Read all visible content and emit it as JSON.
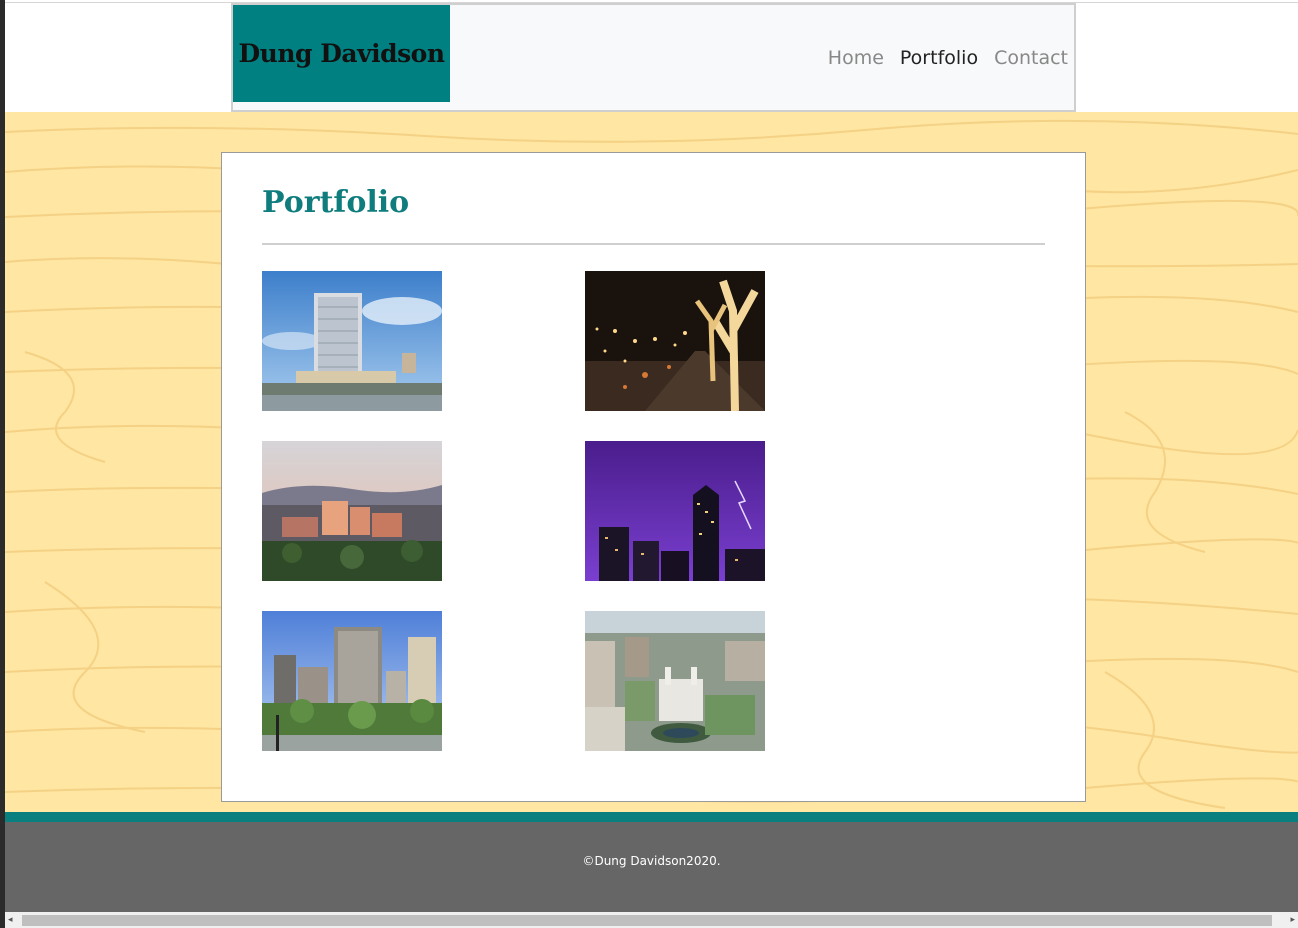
{
  "site": {
    "brand": "Dung Davidson"
  },
  "nav": {
    "items": [
      {
        "label": "Home",
        "active": false
      },
      {
        "label": "Portfolio",
        "active": true
      },
      {
        "label": "Contact",
        "active": false
      }
    ]
  },
  "main": {
    "title": "Portfolio",
    "gallery": [
      {
        "subject": "hotel-tower-daytime"
      },
      {
        "subject": "street-trees-holiday-lights-night"
      },
      {
        "subject": "city-skyline-dusk"
      },
      {
        "subject": "skyscraper-lightning-storm"
      },
      {
        "subject": "downtown-towers-park"
      },
      {
        "subject": "aerial-city-temple"
      }
    ]
  },
  "footer": {
    "text": "©Dung Davidson2020."
  },
  "colors": {
    "brand_bg": "#008080",
    "title": "#0f7d7d",
    "wood": "#ffe6a2",
    "footer_bg": "#666666",
    "footer_stripe": "#0a7f7f"
  }
}
